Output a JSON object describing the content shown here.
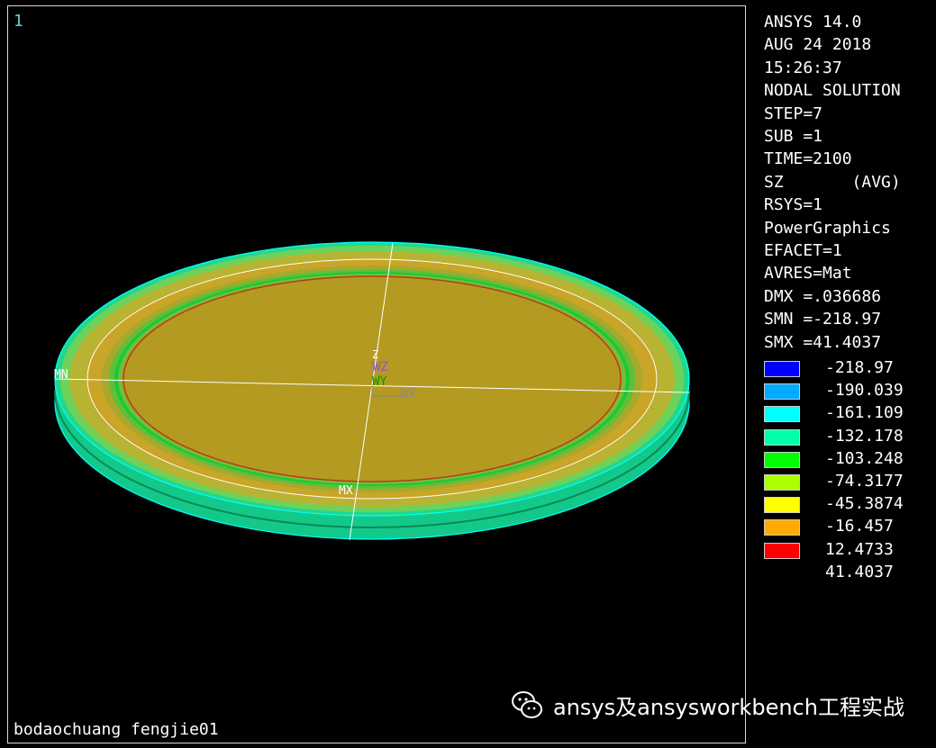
{
  "window_number": "1",
  "caption": "bodaochuang fengjie01",
  "info_lines": [
    "ANSYS 14.0",
    "AUG 24 2018",
    "15:26:37",
    "NODAL SOLUTION",
    "STEP=7",
    "SUB =1",
    "TIME=2100",
    "SZ       (AVG)",
    "RSYS=1",
    "PowerGraphics",
    "EFACET=1",
    "AVRES=Mat",
    "DMX =.036686",
    "SMN =-218.97",
    "SMX =41.4037"
  ],
  "legend": [
    {
      "value": "-218.97",
      "color": "#0000ff"
    },
    {
      "value": "-190.039",
      "color": "#00aaff"
    },
    {
      "value": "-161.109",
      "color": "#00ffff"
    },
    {
      "value": "-132.178",
      "color": "#00ffaa"
    },
    {
      "value": "-103.248",
      "color": "#00ff00"
    },
    {
      "value": "-74.3177",
      "color": "#aaff00"
    },
    {
      "value": "-45.3874",
      "color": "#ffff00"
    },
    {
      "value": "-16.457",
      "color": "#ffaa00"
    },
    {
      "value": "12.4733",
      "color": "#ff0000"
    },
    {
      "value": "41.4037",
      "color": null
    }
  ],
  "markers": {
    "min": "MN",
    "max": "MX",
    "axis_z": "Z",
    "axis_wz": "WZ",
    "axis_wy": "WY",
    "axis_wx": "WX"
  },
  "watermark": "ansys及ansysworkbench工程实战",
  "icons": {
    "watermark": "wechat-icon"
  }
}
